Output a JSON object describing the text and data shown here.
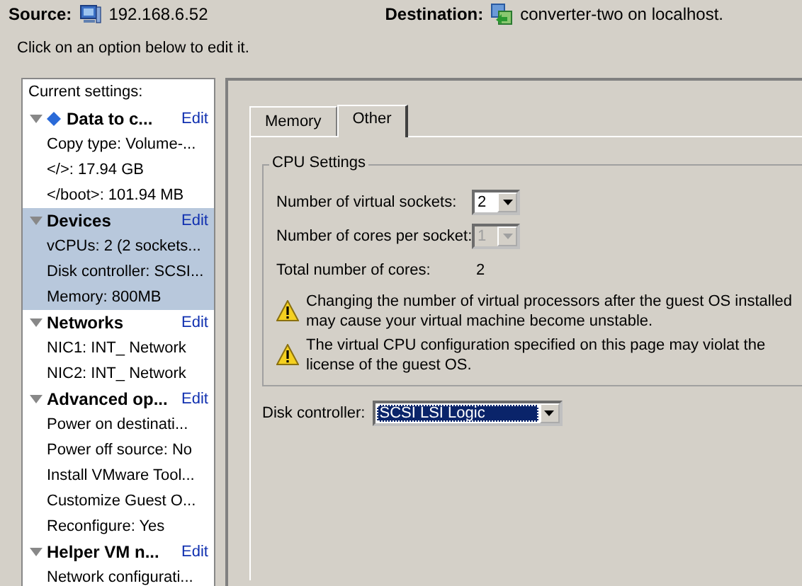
{
  "header": {
    "source_label": "Source:",
    "source_value": "192.168.6.52",
    "destination_label": "Destination:",
    "destination_value": "converter-two on localhost."
  },
  "instruction": "Click on an option below to edit it.",
  "sidebar": {
    "title": "Current settings:",
    "sections": [
      {
        "title": "Data to c...",
        "status_icon": true,
        "expanded": true,
        "selected": false,
        "edit": "Edit",
        "items": [
          "Copy type: Volume-...",
          "</>: 17.94 GB",
          "</boot>: 101.94 MB"
        ]
      },
      {
        "title": "Devices",
        "status_icon": false,
        "expanded": true,
        "selected": true,
        "edit": "Edit",
        "items": [
          "vCPUs: 2 (2 sockets...",
          "Disk controller: SCSI...",
          "Memory: 800MB"
        ]
      },
      {
        "title": "Networks",
        "status_icon": false,
        "expanded": true,
        "selected": false,
        "edit": "Edit",
        "items": [
          "NIC1: INT_ Network",
          "NIC2: INT_ Network"
        ]
      },
      {
        "title": "Advanced op...",
        "status_icon": false,
        "expanded": true,
        "selected": false,
        "edit": "Edit",
        "items": [
          "Power on destinati...",
          "Power off source: No",
          "Install VMware Tool...",
          "Customize Guest O...",
          "Reconfigure: Yes"
        ]
      },
      {
        "title": "Helper VM n...",
        "status_icon": false,
        "expanded": true,
        "selected": false,
        "edit": "Edit",
        "items": [
          "Network configurati..."
        ]
      }
    ]
  },
  "tabs": [
    {
      "label": "Memory",
      "selected": false
    },
    {
      "label": "Other",
      "selected": true
    }
  ],
  "cpu_settings": {
    "title": "CPU Settings",
    "fields": [
      {
        "kind": "dropdown",
        "label": "Number of virtual sockets:",
        "value": "2",
        "disabled": false
      },
      {
        "kind": "dropdown",
        "label": "Number of cores per socket:",
        "value": "1",
        "disabled": true
      },
      {
        "kind": "text",
        "label": "Total number of cores:",
        "value": "2"
      }
    ],
    "warnings": [
      "Changing the number of virtual processors after the guest OS installed may cause your virtual machine become unstable.",
      "The virtual CPU configuration specified on this page may violat the license of the guest OS."
    ]
  },
  "disk_controller": {
    "label": "Disk controller:",
    "value": "SCSI LSI Logic",
    "focused": true
  }
}
